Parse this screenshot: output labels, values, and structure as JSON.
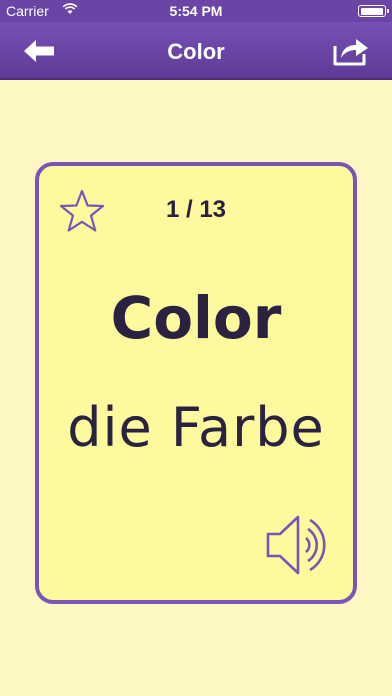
{
  "status_bar": {
    "carrier": "Carrier",
    "time": "5:54 PM",
    "wifi_icon": "wifi-icon",
    "battery_icon": "battery-icon"
  },
  "nav_bar": {
    "title": "Color",
    "back_icon": "back-arrow-icon",
    "share_icon": "share-icon"
  },
  "card": {
    "counter": "1 / 13",
    "word": "Color",
    "translation": "die Farbe",
    "favorite_icon": "star-icon",
    "audio_icon": "speaker-icon"
  },
  "colors": {
    "nav_bar": "#6a45a6",
    "background": "#fdf7c4",
    "card_fill": "#fcfa9c",
    "card_border": "#7a55b8",
    "text": "#2b2140"
  }
}
